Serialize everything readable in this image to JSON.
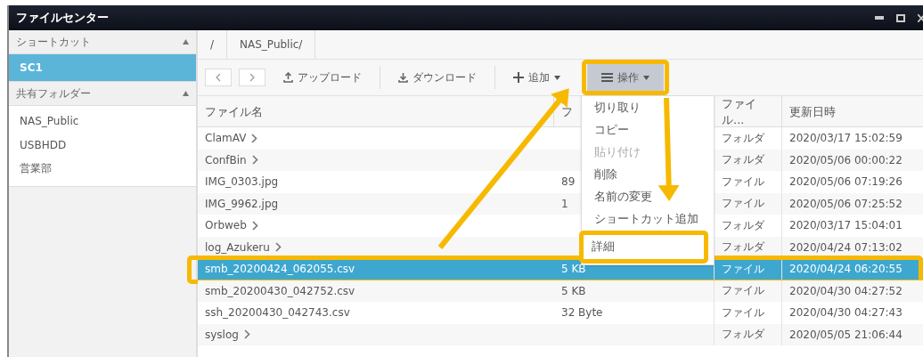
{
  "window": {
    "title": "ファイルセンター"
  },
  "sidebar": {
    "sections": [
      {
        "title": "ショートカット",
        "expanded": true,
        "items": [
          {
            "label": "SC1",
            "selected": true
          }
        ]
      },
      {
        "title": "共有フォルダー",
        "expanded": true,
        "items": [
          {
            "label": "NAS_Public",
            "selected": false
          },
          {
            "label": "USBHDD",
            "selected": false
          },
          {
            "label": "営業部",
            "selected": false
          }
        ]
      }
    ]
  },
  "breadcrumb": [
    {
      "label": "/"
    },
    {
      "label": "NAS_Public/"
    }
  ],
  "toolbar": [
    {
      "kind": "back",
      "disabled": true
    },
    {
      "kind": "forward",
      "disabled": true
    },
    {
      "kind": "upload",
      "label": "アップロード"
    },
    {
      "kind": "download",
      "label": "ダウンロード"
    },
    {
      "kind": "add",
      "label": "追加"
    },
    {
      "kind": "actions",
      "label": "操作",
      "pressed": true,
      "highlighted": true
    }
  ],
  "menu": {
    "items": [
      {
        "label": "切り取り",
        "disabled": false,
        "highlighted": false
      },
      {
        "label": "コピー",
        "disabled": false,
        "highlighted": false
      },
      {
        "label": "貼り付け",
        "disabled": true,
        "highlighted": false
      },
      {
        "label": "削除",
        "disabled": false,
        "highlighted": false
      },
      {
        "label": "名前の変更",
        "disabled": false,
        "highlighted": false
      },
      {
        "label": "ショートカット追加",
        "disabled": false,
        "highlighted": false
      },
      {
        "label": "詳細",
        "disabled": false,
        "highlighted": true
      }
    ]
  },
  "table": {
    "columns": [
      "ファイル名",
      "フ",
      "ファイル...",
      "更新日時"
    ],
    "rows": [
      {
        "name": "ClamAV",
        "folder": true,
        "size": "",
        "type": "フォルダ",
        "modified": "2020/03/17 15:02:59",
        "selected": false,
        "highlighted": false
      },
      {
        "name": "ConfBin",
        "folder": true,
        "size": "",
        "type": "フォルダ",
        "modified": "2020/05/06 00:00:22",
        "selected": false,
        "highlighted": false
      },
      {
        "name": "IMG_0303.jpg",
        "folder": false,
        "size": "89",
        "type": "ファイル",
        "modified": "2020/05/06 07:19:26",
        "selected": false,
        "highlighted": false
      },
      {
        "name": "IMG_9962.jpg",
        "folder": false,
        "size": "1",
        "type": "ファイル",
        "modified": "2020/05/06 07:25:52",
        "selected": false,
        "highlighted": false
      },
      {
        "name": "Orbweb",
        "folder": true,
        "size": "",
        "type": "フォルダ",
        "modified": "2020/03/17 15:04:01",
        "selected": false,
        "highlighted": false
      },
      {
        "name": "log_Azukeru",
        "folder": true,
        "size": "",
        "type": "フォルダ",
        "modified": "2020/04/24 07:13:02",
        "selected": false,
        "highlighted": false
      },
      {
        "name": "smb_20200424_062055.csv",
        "folder": false,
        "size": "5 KB",
        "type": "ファイル",
        "modified": "2020/04/24 06:20:55",
        "selected": true,
        "highlighted": true
      },
      {
        "name": "smb_20200430_042752.csv",
        "folder": false,
        "size": "5 KB",
        "type": "ファイル",
        "modified": "2020/04/30 04:27:52",
        "selected": false,
        "highlighted": false
      },
      {
        "name": "ssh_20200430_042743.csv",
        "folder": false,
        "size": "32 Byte",
        "type": "ファイル",
        "modified": "2020/04/30 04:27:43",
        "selected": false,
        "highlighted": false
      },
      {
        "name": "syslog",
        "folder": true,
        "size": "",
        "type": "フォルダ",
        "modified": "2020/05/05 21:06:44",
        "selected": false,
        "highlighted": false
      }
    ]
  }
}
